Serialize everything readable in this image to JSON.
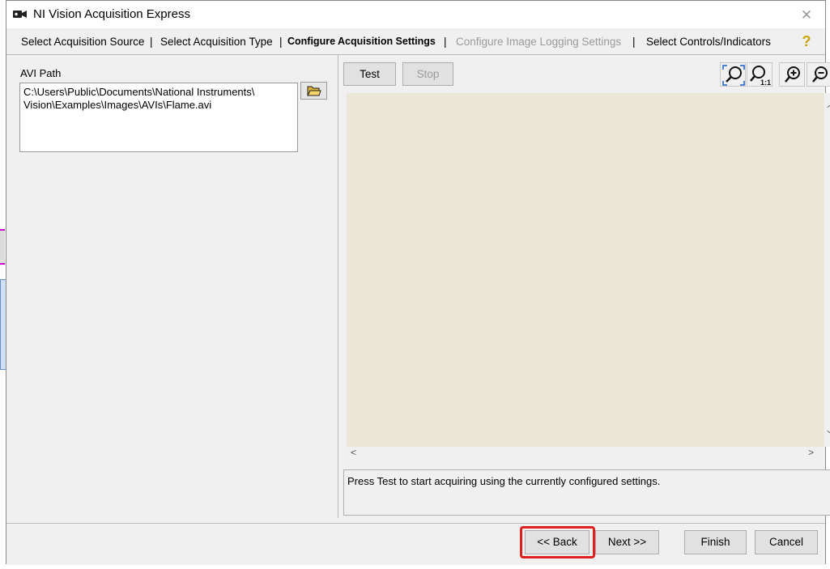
{
  "window": {
    "title": "NI Vision Acquisition Express"
  },
  "steps": [
    {
      "label": "Select Acquisition Source",
      "state": "normal"
    },
    {
      "label": "Select Acquisition Type",
      "state": "normal"
    },
    {
      "label": "Configure Acquisition Settings",
      "state": "active"
    },
    {
      "label": "Configure Image Logging Settings",
      "state": "disabled"
    },
    {
      "label": "Select Controls/Indicators",
      "state": "normal"
    }
  ],
  "step_separator": "|",
  "left": {
    "avi_label": "AVI Path",
    "avi_path_line1": "C:\\Users\\Public\\Documents\\National Instruments\\",
    "avi_path_line2": "Vision\\Examples\\Images\\AVIs\\Flame.avi"
  },
  "toolbar": {
    "test_label": "Test",
    "stop_label": "Stop"
  },
  "icons": {
    "zoom_fit": "zoom-to-fit-icon",
    "zoom_1to1": "zoom-1-1-icon",
    "zoom_in": "zoom-in-icon",
    "zoom_out": "zoom-out-icon",
    "zoom_1to1_text": "1:1"
  },
  "status": {
    "message": "Press Test to start acquiring using the currently configured settings."
  },
  "footer": {
    "back_label": "<< Back",
    "next_label": "Next >>",
    "finish_label": "Finish",
    "cancel_label": "Cancel"
  },
  "colors": {
    "viewer_bg": "#ebe8da",
    "highlight": "#e02020",
    "dialog_bg": "#f0f0f0"
  }
}
